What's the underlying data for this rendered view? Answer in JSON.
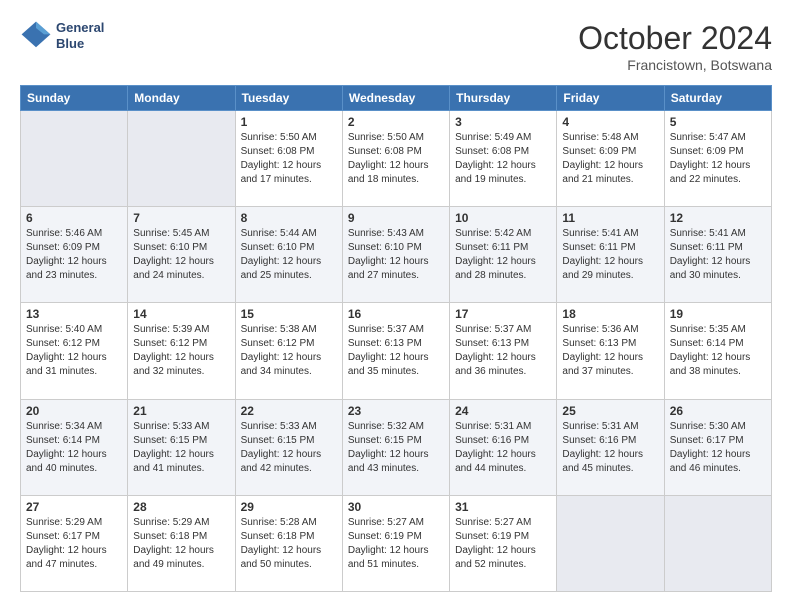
{
  "header": {
    "logo_line1": "General",
    "logo_line2": "Blue",
    "month": "October 2024",
    "location": "Francistown, Botswana"
  },
  "weekdays": [
    "Sunday",
    "Monday",
    "Tuesday",
    "Wednesday",
    "Thursday",
    "Friday",
    "Saturday"
  ],
  "weeks": [
    [
      {
        "day": "",
        "empty": true
      },
      {
        "day": "",
        "empty": true
      },
      {
        "day": "1",
        "sunrise": "Sunrise: 5:50 AM",
        "sunset": "Sunset: 6:08 PM",
        "daylight": "Daylight: 12 hours and 17 minutes."
      },
      {
        "day": "2",
        "sunrise": "Sunrise: 5:50 AM",
        "sunset": "Sunset: 6:08 PM",
        "daylight": "Daylight: 12 hours and 18 minutes."
      },
      {
        "day": "3",
        "sunrise": "Sunrise: 5:49 AM",
        "sunset": "Sunset: 6:08 PM",
        "daylight": "Daylight: 12 hours and 19 minutes."
      },
      {
        "day": "4",
        "sunrise": "Sunrise: 5:48 AM",
        "sunset": "Sunset: 6:09 PM",
        "daylight": "Daylight: 12 hours and 21 minutes."
      },
      {
        "day": "5",
        "sunrise": "Sunrise: 5:47 AM",
        "sunset": "Sunset: 6:09 PM",
        "daylight": "Daylight: 12 hours and 22 minutes."
      }
    ],
    [
      {
        "day": "6",
        "sunrise": "Sunrise: 5:46 AM",
        "sunset": "Sunset: 6:09 PM",
        "daylight": "Daylight: 12 hours and 23 minutes."
      },
      {
        "day": "7",
        "sunrise": "Sunrise: 5:45 AM",
        "sunset": "Sunset: 6:10 PM",
        "daylight": "Daylight: 12 hours and 24 minutes."
      },
      {
        "day": "8",
        "sunrise": "Sunrise: 5:44 AM",
        "sunset": "Sunset: 6:10 PM",
        "daylight": "Daylight: 12 hours and 25 minutes."
      },
      {
        "day": "9",
        "sunrise": "Sunrise: 5:43 AM",
        "sunset": "Sunset: 6:10 PM",
        "daylight": "Daylight: 12 hours and 27 minutes."
      },
      {
        "day": "10",
        "sunrise": "Sunrise: 5:42 AM",
        "sunset": "Sunset: 6:11 PM",
        "daylight": "Daylight: 12 hours and 28 minutes."
      },
      {
        "day": "11",
        "sunrise": "Sunrise: 5:41 AM",
        "sunset": "Sunset: 6:11 PM",
        "daylight": "Daylight: 12 hours and 29 minutes."
      },
      {
        "day": "12",
        "sunrise": "Sunrise: 5:41 AM",
        "sunset": "Sunset: 6:11 PM",
        "daylight": "Daylight: 12 hours and 30 minutes."
      }
    ],
    [
      {
        "day": "13",
        "sunrise": "Sunrise: 5:40 AM",
        "sunset": "Sunset: 6:12 PM",
        "daylight": "Daylight: 12 hours and 31 minutes."
      },
      {
        "day": "14",
        "sunrise": "Sunrise: 5:39 AM",
        "sunset": "Sunset: 6:12 PM",
        "daylight": "Daylight: 12 hours and 32 minutes."
      },
      {
        "day": "15",
        "sunrise": "Sunrise: 5:38 AM",
        "sunset": "Sunset: 6:12 PM",
        "daylight": "Daylight: 12 hours and 34 minutes."
      },
      {
        "day": "16",
        "sunrise": "Sunrise: 5:37 AM",
        "sunset": "Sunset: 6:13 PM",
        "daylight": "Daylight: 12 hours and 35 minutes."
      },
      {
        "day": "17",
        "sunrise": "Sunrise: 5:37 AM",
        "sunset": "Sunset: 6:13 PM",
        "daylight": "Daylight: 12 hours and 36 minutes."
      },
      {
        "day": "18",
        "sunrise": "Sunrise: 5:36 AM",
        "sunset": "Sunset: 6:13 PM",
        "daylight": "Daylight: 12 hours and 37 minutes."
      },
      {
        "day": "19",
        "sunrise": "Sunrise: 5:35 AM",
        "sunset": "Sunset: 6:14 PM",
        "daylight": "Daylight: 12 hours and 38 minutes."
      }
    ],
    [
      {
        "day": "20",
        "sunrise": "Sunrise: 5:34 AM",
        "sunset": "Sunset: 6:14 PM",
        "daylight": "Daylight: 12 hours and 40 minutes."
      },
      {
        "day": "21",
        "sunrise": "Sunrise: 5:33 AM",
        "sunset": "Sunset: 6:15 PM",
        "daylight": "Daylight: 12 hours and 41 minutes."
      },
      {
        "day": "22",
        "sunrise": "Sunrise: 5:33 AM",
        "sunset": "Sunset: 6:15 PM",
        "daylight": "Daylight: 12 hours and 42 minutes."
      },
      {
        "day": "23",
        "sunrise": "Sunrise: 5:32 AM",
        "sunset": "Sunset: 6:15 PM",
        "daylight": "Daylight: 12 hours and 43 minutes."
      },
      {
        "day": "24",
        "sunrise": "Sunrise: 5:31 AM",
        "sunset": "Sunset: 6:16 PM",
        "daylight": "Daylight: 12 hours and 44 minutes."
      },
      {
        "day": "25",
        "sunrise": "Sunrise: 5:31 AM",
        "sunset": "Sunset: 6:16 PM",
        "daylight": "Daylight: 12 hours and 45 minutes."
      },
      {
        "day": "26",
        "sunrise": "Sunrise: 5:30 AM",
        "sunset": "Sunset: 6:17 PM",
        "daylight": "Daylight: 12 hours and 46 minutes."
      }
    ],
    [
      {
        "day": "27",
        "sunrise": "Sunrise: 5:29 AM",
        "sunset": "Sunset: 6:17 PM",
        "daylight": "Daylight: 12 hours and 47 minutes."
      },
      {
        "day": "28",
        "sunrise": "Sunrise: 5:29 AM",
        "sunset": "Sunset: 6:18 PM",
        "daylight": "Daylight: 12 hours and 49 minutes."
      },
      {
        "day": "29",
        "sunrise": "Sunrise: 5:28 AM",
        "sunset": "Sunset: 6:18 PM",
        "daylight": "Daylight: 12 hours and 50 minutes."
      },
      {
        "day": "30",
        "sunrise": "Sunrise: 5:27 AM",
        "sunset": "Sunset: 6:19 PM",
        "daylight": "Daylight: 12 hours and 51 minutes."
      },
      {
        "day": "31",
        "sunrise": "Sunrise: 5:27 AM",
        "sunset": "Sunset: 6:19 PM",
        "daylight": "Daylight: 12 hours and 52 minutes."
      },
      {
        "day": "",
        "empty": true
      },
      {
        "day": "",
        "empty": true
      }
    ]
  ]
}
